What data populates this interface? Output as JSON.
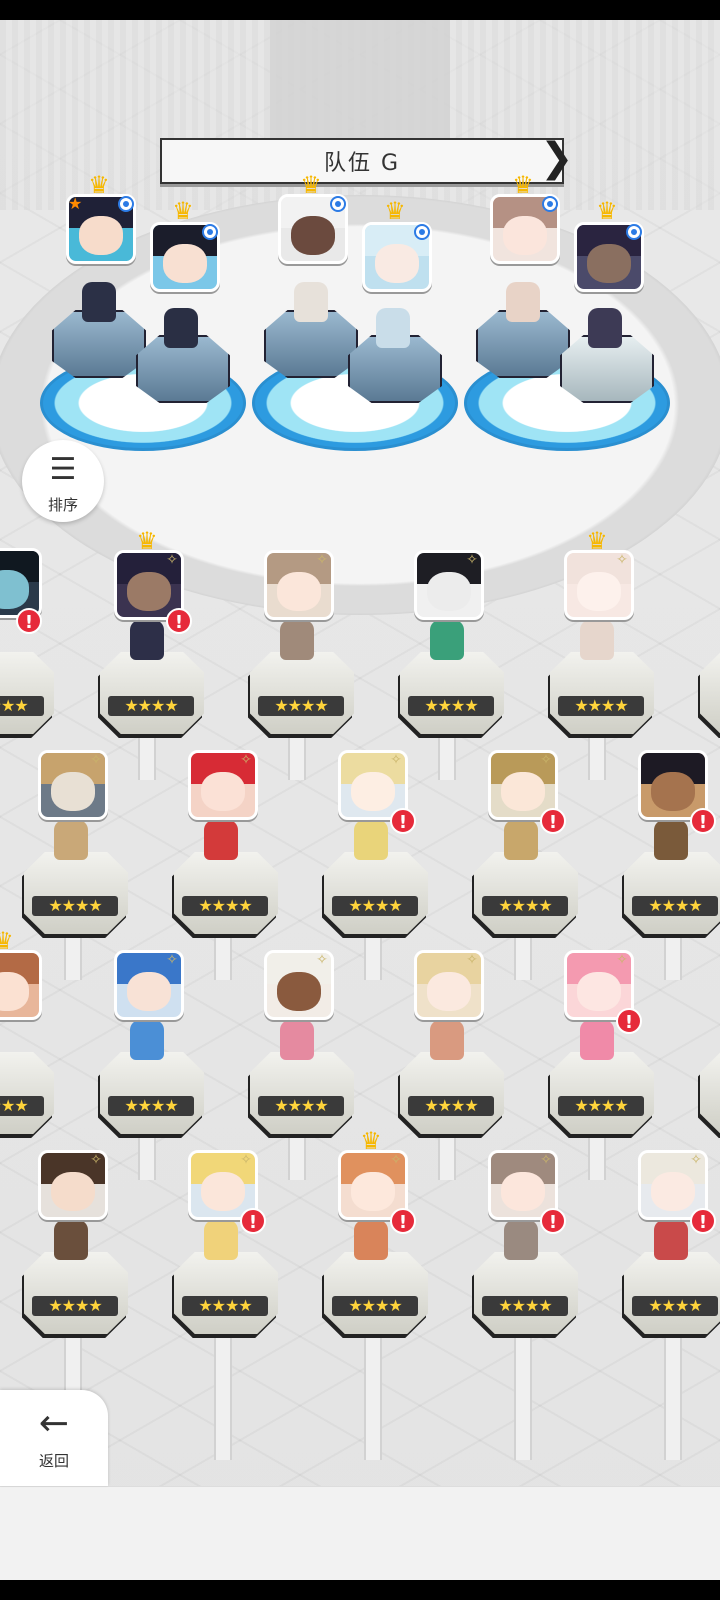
{
  "team": {
    "title": "队伍 G",
    "prev_label": "❮",
    "next_label": "❯"
  },
  "sort_button": {
    "label": "排序",
    "icon": "sort-icon"
  },
  "back_button": {
    "label": "返回",
    "icon": "back-arrow-icon"
  },
  "ratings": {
    "four_star": "★★★★"
  },
  "alert_glyph": "!",
  "sparkle_glyph": "✧",
  "crown_glyph": "♛",
  "colors": {
    "alert": "#e62a3a",
    "crown": "#f6b700",
    "selected_badge": "#2c7be5",
    "star": "#ffd43b"
  }
}
